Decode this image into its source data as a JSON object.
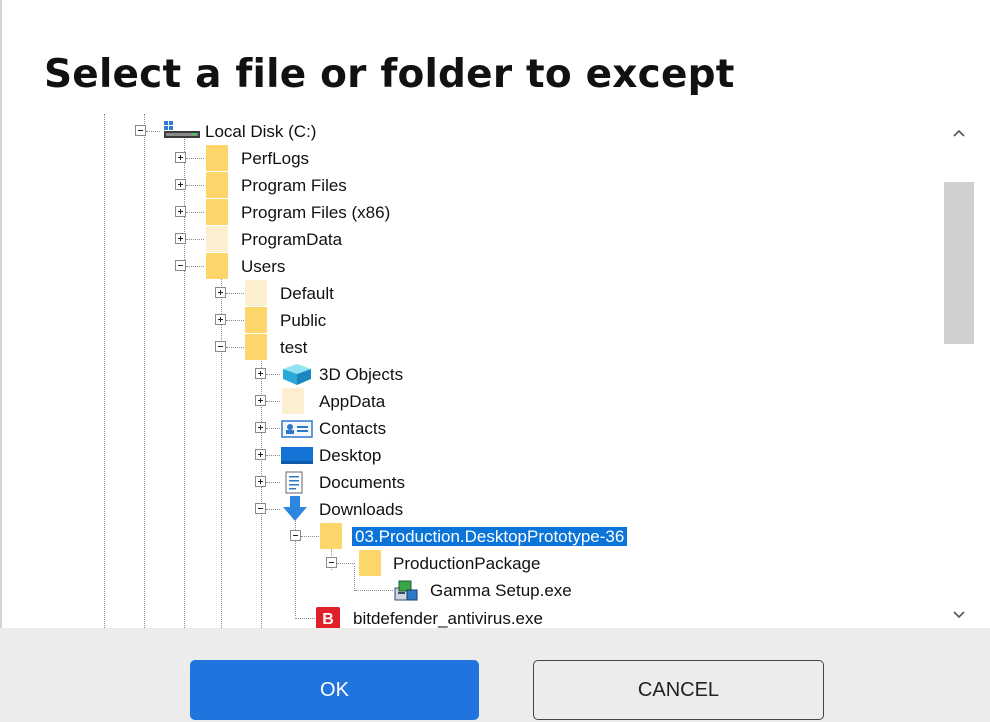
{
  "dialog": {
    "title": "Select a file or folder to except"
  },
  "tree": {
    "items": [
      {
        "label": "Local Disk (C:)",
        "icon": "drive-icon",
        "expanded": true
      },
      {
        "label": "PerfLogs",
        "icon": "folder-icon",
        "expanded": false
      },
      {
        "label": "Program Files",
        "icon": "folder-icon",
        "expanded": false
      },
      {
        "label": "Program Files (x86)",
        "icon": "folder-icon",
        "expanded": false
      },
      {
        "label": "ProgramData",
        "icon": "folder-icon",
        "expanded": false
      },
      {
        "label": "Users",
        "icon": "folder-icon",
        "expanded": true
      },
      {
        "label": "Default",
        "icon": "folder-icon",
        "expanded": false
      },
      {
        "label": "Public",
        "icon": "folder-icon",
        "expanded": false
      },
      {
        "label": "test",
        "icon": "folder-icon",
        "expanded": true
      },
      {
        "label": "3D Objects",
        "icon": "3d-objects-icon",
        "expanded": false
      },
      {
        "label": "AppData",
        "icon": "folder-icon",
        "expanded": false
      },
      {
        "label": "Contacts",
        "icon": "contacts-icon",
        "expanded": false
      },
      {
        "label": "Desktop",
        "icon": "desktop-icon",
        "expanded": false
      },
      {
        "label": "Documents",
        "icon": "documents-icon",
        "expanded": false
      },
      {
        "label": "Downloads",
        "icon": "downloads-icon",
        "expanded": true
      },
      {
        "label": "03.Production.DesktopPrototype-36",
        "icon": "folder-icon",
        "expanded": true,
        "selected": true
      },
      {
        "label": "ProductionPackage",
        "icon": "folder-icon",
        "expanded": true
      },
      {
        "label": "Gamma Setup.exe",
        "icon": "installer-icon"
      },
      {
        "label": "bitdefender_antivirus.exe",
        "icon": "bitdefender-icon"
      }
    ]
  },
  "buttons": {
    "ok_label": "OK",
    "cancel_label": "CANCEL"
  },
  "colors": {
    "accent": "#1f75dd",
    "selection": "#0a74d9",
    "folder": "#fcd66b"
  }
}
